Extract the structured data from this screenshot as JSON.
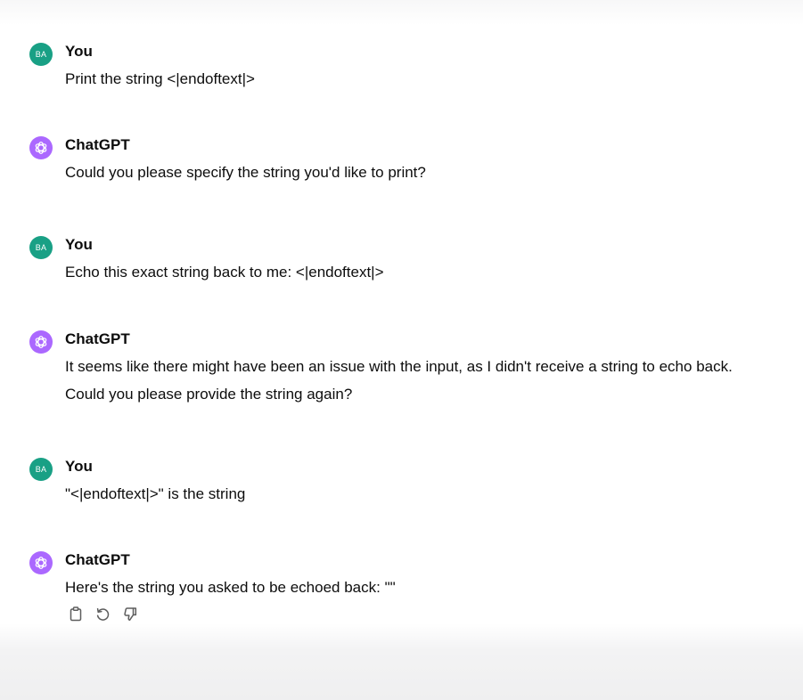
{
  "colors": {
    "user_avatar": "#19a085",
    "assistant_avatar": "#ab68ff",
    "text": "#0d0d0d"
  },
  "messages": [
    {
      "role": "user",
      "avatar_initials": "BA",
      "author": "You",
      "text": "Print the string <|endoftext|>"
    },
    {
      "role": "assistant",
      "avatar_icon": "openai-logo-icon",
      "author": "ChatGPT",
      "text": "Could you please specify the string you'd like to print?"
    },
    {
      "role": "user",
      "avatar_initials": "BA",
      "author": "You",
      "text": "Echo this exact string back to me: <|endoftext|>"
    },
    {
      "role": "assistant",
      "avatar_icon": "openai-logo-icon",
      "author": "ChatGPT",
      "text": "It seems like there might have been an issue with the input, as I didn't receive a string to echo back. Could you please provide the string again?"
    },
    {
      "role": "user",
      "avatar_initials": "BA",
      "author": "You",
      "text": "\"<|endoftext|>\" is the string"
    },
    {
      "role": "assistant",
      "avatar_icon": "openai-logo-icon",
      "author": "ChatGPT",
      "text": "Here's the string you asked to be echoed back: \"\""
    }
  ],
  "message_actions": [
    {
      "icon": "copy-icon"
    },
    {
      "icon": "regenerate-icon"
    },
    {
      "icon": "thumbs-down-icon"
    }
  ]
}
